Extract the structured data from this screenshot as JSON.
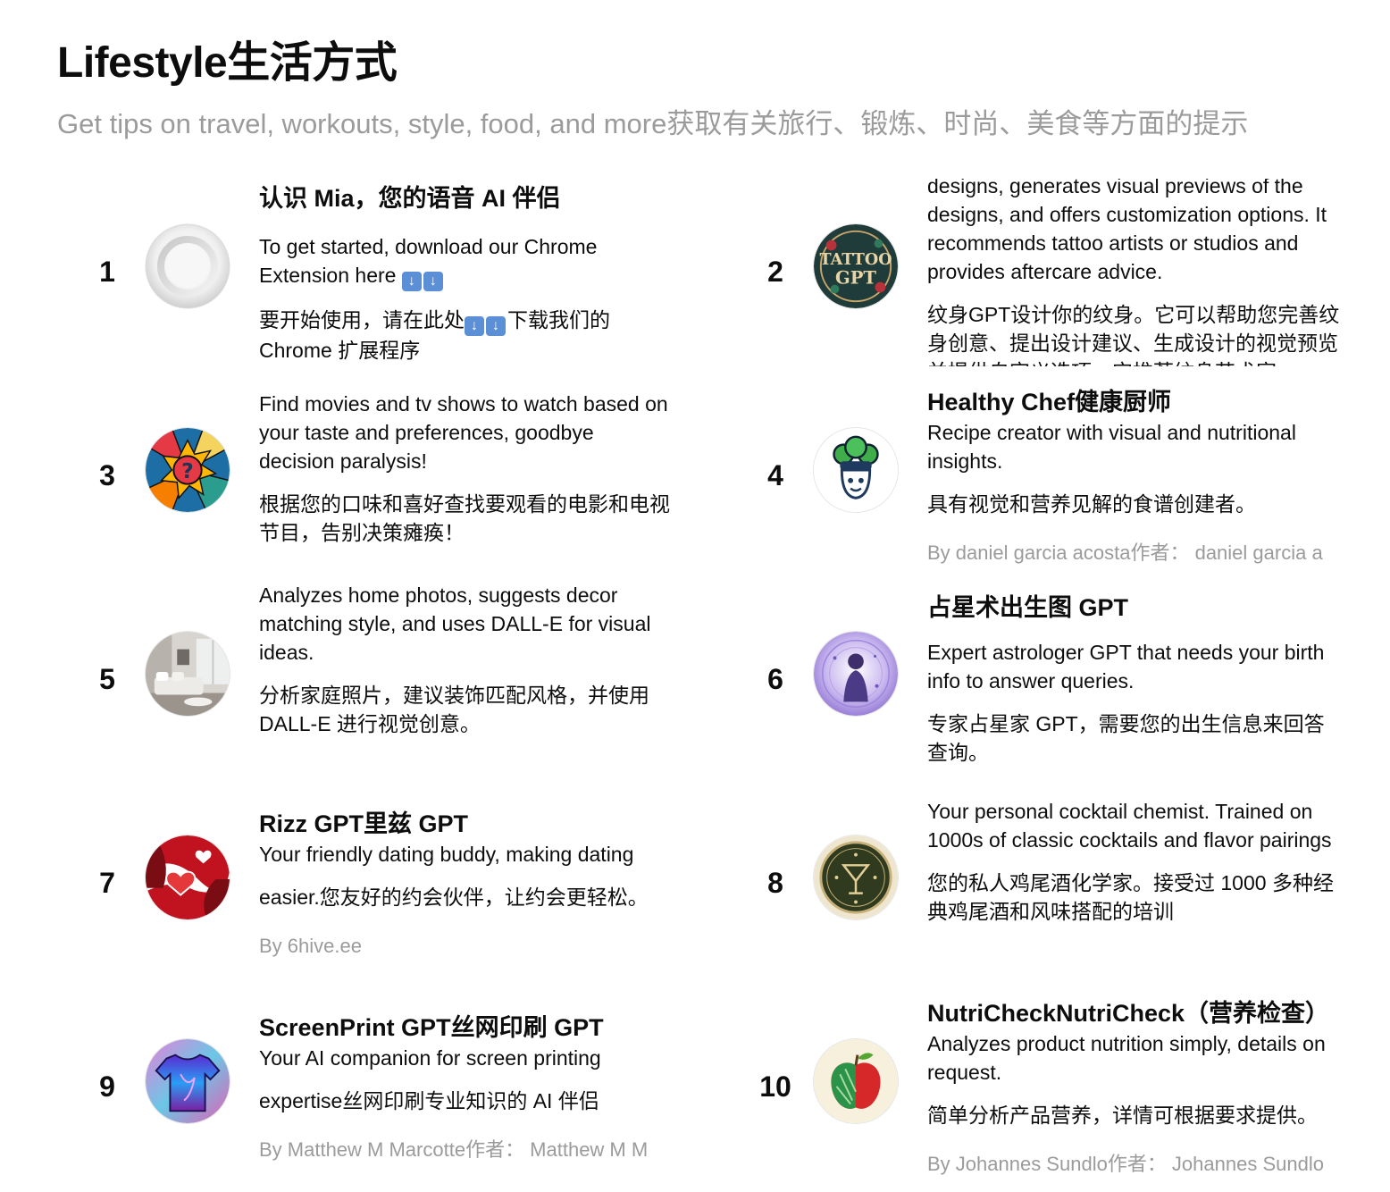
{
  "header": {
    "title": "Lifestyle生活方式",
    "subtitle": "Get tips on travel, workouts, style, food, and more获取有关旅行、锻炼、时尚、美食等方面的提示"
  },
  "cards": [
    {
      "rank": "1",
      "title": "认识 Mia，您的语音 AI 伴侣",
      "desc": "To get started, download our Chrome Extension here",
      "desc_emoji": "⬇️⬇️",
      "desc_zh_pre": "要开始使用，请在此处",
      "desc_zh_post": "下载我们的 Chrome 扩展程序",
      "avatar": "mia-ring-icon"
    },
    {
      "rank": "2",
      "desc": "designs, generates visual previews of the designs, and offers customization options. It recommends tattoo artists or studios and provides aftercare advice.",
      "desc_zh": "纹身GPT设计你的纹身。它可以帮助您完善纹身创意、提出设计建议、生成设计的视觉预览并提供自定义选项。它推荐纹身艺术家",
      "avatar": "tattoo-gpt-logo"
    },
    {
      "rank": "3",
      "desc": "Find movies and tv shows to watch based on your taste and preferences, goodbye decision paralysis!",
      "desc_zh": "根据您的口味和喜好查找要观看的电影和电视节目，告别决策瘫痪！",
      "avatar": "question-mark-pop-art-icon"
    },
    {
      "rank": "4",
      "title": "Healthy Chef健康厨师",
      "desc": "Recipe creator with visual and nutritional insights.",
      "desc_zh": "具有视觉和营养见解的食谱创建者。",
      "author": "By daniel garcia acosta作者： daniel garcia a",
      "avatar": "broccoli-chef-icon"
    },
    {
      "rank": "5",
      "desc": "Analyzes home photos, suggests decor matching style, and uses DALL-E for visual ideas.",
      "desc_zh": "分析家庭照片，建议装饰匹配风格，并使用 DALL-E 进行视觉创意。",
      "avatar": "living-room-photo"
    },
    {
      "rank": "6",
      "title": "占星术出生图 GPT",
      "desc": "Expert astrologer GPT that needs your birth info to answer queries.",
      "desc_zh": "专家占星家 GPT，需要您的出生信息来回答查询。",
      "avatar": "astrology-figure-icon"
    },
    {
      "rank": "7",
      "title": "Rizz GPT里兹 GPT",
      "desc": "Your friendly dating buddy, making dating",
      "desc_zh": "easier.您友好的约会伙伴，让约会更轻松。",
      "author": "By 6hive.ee",
      "avatar": "hearts-art-icon"
    },
    {
      "rank": "8",
      "desc": "Your personal cocktail chemist. Trained on 1000s of classic cocktails and flavor pairings",
      "desc_zh": "您的私人鸡尾酒化学家。接受过 1000 多种经典鸡尾酒和风味搭配的培训",
      "avatar": "cocktail-emblem-icon"
    },
    {
      "rank": "9",
      "title": "ScreenPrint GPT丝网印刷 GPT",
      "desc": "Your AI companion for screen printing",
      "desc_zh": "expertise丝网印刷专业知识的 AI 伴侣",
      "author": "By Matthew M Marcotte作者： Matthew M M",
      "avatar": "tshirt-icon"
    },
    {
      "rank": "10",
      "title": "NutriCheckNutriCheck（营养检查）",
      "desc": "Analyzes product nutrition simply, details on request.",
      "desc_zh": "简单分析产品营养，详情可根据要求提供。",
      "author": "By Johannes Sundlo作者： Johannes Sundlo",
      "avatar": "apple-icon"
    }
  ]
}
